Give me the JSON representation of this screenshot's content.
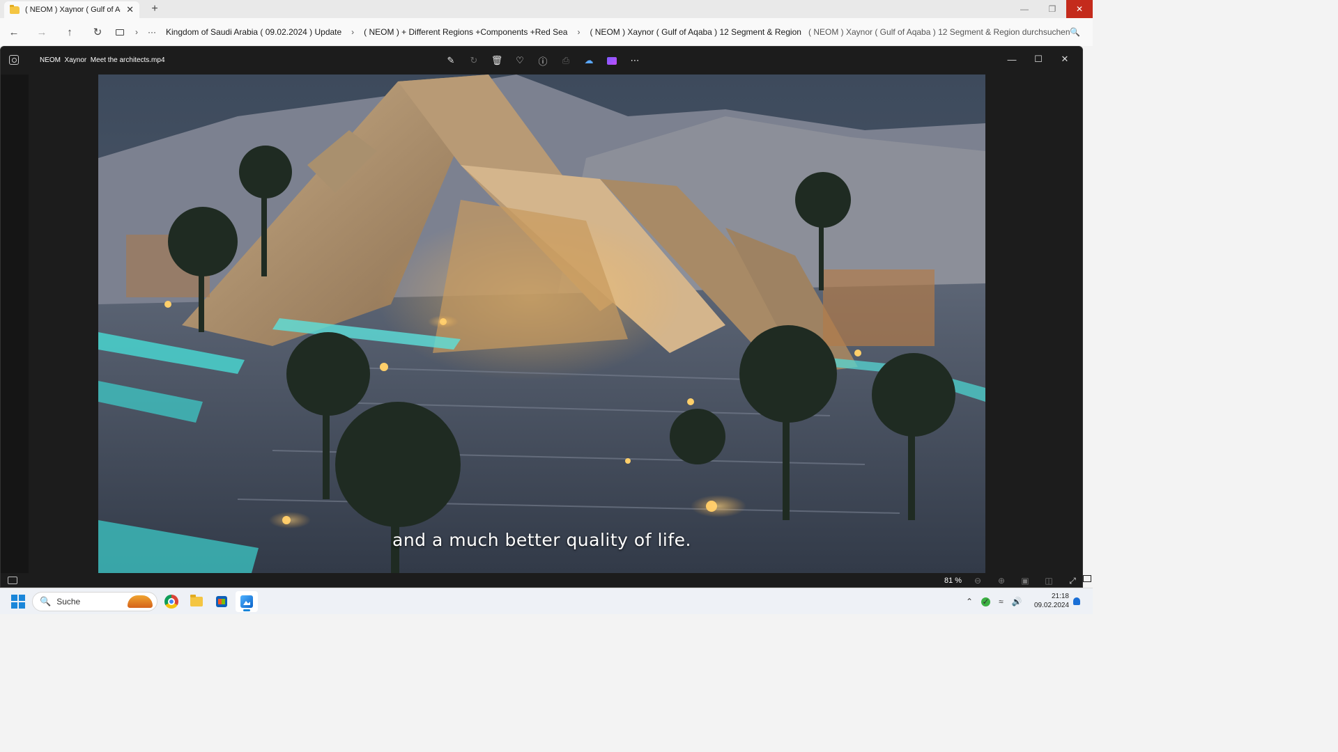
{
  "explorer": {
    "tab_title": "( NEOM ) Xaynor ( Gulf of Aqa",
    "tab_close": "✕",
    "new_tab": "+",
    "window_controls": {
      "minimize": "—",
      "restore": "❐",
      "close": "✕"
    },
    "nav": {
      "back": "←",
      "forward": "→",
      "up": "↑",
      "refresh": "↻"
    },
    "breadcrumbs": [
      "Kingdom of Saudi Arabia ( 09.02.2024 ) Update",
      "( NEOM ) + Different Regions +Components +Red Sea",
      "( NEOM ) Xaynor ( Gulf of Aqaba ) 12 Segment & Region"
    ],
    "breadcrumb_overflow": "···",
    "breadcrumb_separator": "›",
    "search_placeholder": "( NEOM ) Xaynor ( Gulf of Aqaba ) 12 Segment & Region durchsuchen"
  },
  "viewer": {
    "title": "NEOM  Xaynor  Meet the architects.mp4",
    "toolbar": [
      "edit-icon",
      "rotate-icon",
      "delete-icon",
      "favorite-icon",
      "info-icon",
      "print-icon",
      "onedrive-icon",
      "clipchamp-icon",
      "more-icon"
    ],
    "window_controls": {
      "minimize": "—",
      "maximize": "☐",
      "close": "✕"
    },
    "subtitle": "and a much better quality of life.",
    "zoom": "81 %"
  },
  "taskbar": {
    "search_label": "Suche",
    "apps": [
      "chrome-icon",
      "file-explorer-icon",
      "store-icon",
      "photos-icon"
    ],
    "time": "21:18",
    "date": "09.02.2024"
  },
  "colors": {
    "close_red": "#c42b1c",
    "accent": "#1a86d9",
    "viewer_bg": "#1c1c1c"
  }
}
